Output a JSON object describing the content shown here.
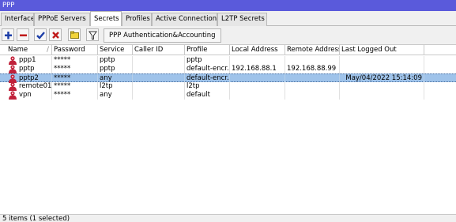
{
  "window": {
    "title": "PPP"
  },
  "tabs": [
    {
      "label": "Interface"
    },
    {
      "label": "PPPoE Servers"
    },
    {
      "label": "Secrets"
    },
    {
      "label": "Profiles"
    },
    {
      "label": "Active Connections"
    },
    {
      "label": "L2TP Secrets"
    }
  ],
  "toolbar": {
    "icons": [
      "add-icon",
      "remove-icon",
      "enable-icon",
      "disable-icon",
      "comment-icon",
      "filter-icon"
    ],
    "auth_button_label": "PPP Authentication&Accounting"
  },
  "table": {
    "columns": [
      "Name",
      "Password",
      "Service",
      "Caller ID",
      "Profile",
      "Local Address",
      "Remote Address",
      "Last Logged Out"
    ],
    "sort_indicator": "/",
    "rows": [
      {
        "name": "ppp1",
        "password": "*****",
        "service": "pptp",
        "caller_id": "",
        "profile": "pptp",
        "local_address": "",
        "remote_address": "",
        "last_logged_out": ""
      },
      {
        "name": "pptp",
        "password": "*****",
        "service": "pptp",
        "caller_id": "",
        "profile": "default-encr...",
        "local_address": "192.168.88.1",
        "remote_address": "192.168.88.99",
        "last_logged_out": ""
      },
      {
        "name": "pptp2",
        "password": "*****",
        "service": "any",
        "caller_id": "",
        "profile": "default-encr...",
        "local_address": "",
        "remote_address": "",
        "last_logged_out": "May/04/2022 15:14:09"
      },
      {
        "name": "remote01",
        "password": "*****",
        "service": "l2tp",
        "caller_id": "",
        "profile": "l2tp",
        "local_address": "",
        "remote_address": "",
        "last_logged_out": ""
      },
      {
        "name": "vpn",
        "password": "*****",
        "service": "any",
        "caller_id": "",
        "profile": "default",
        "local_address": "",
        "remote_address": "",
        "last_logged_out": ""
      }
    ],
    "selected_index": 2
  },
  "status": {
    "text": "5 items (1 selected)"
  },
  "colors": {
    "title_bar": "#5a5adb",
    "selection": "#9fc3ea",
    "user_icon": "#c0213a"
  }
}
